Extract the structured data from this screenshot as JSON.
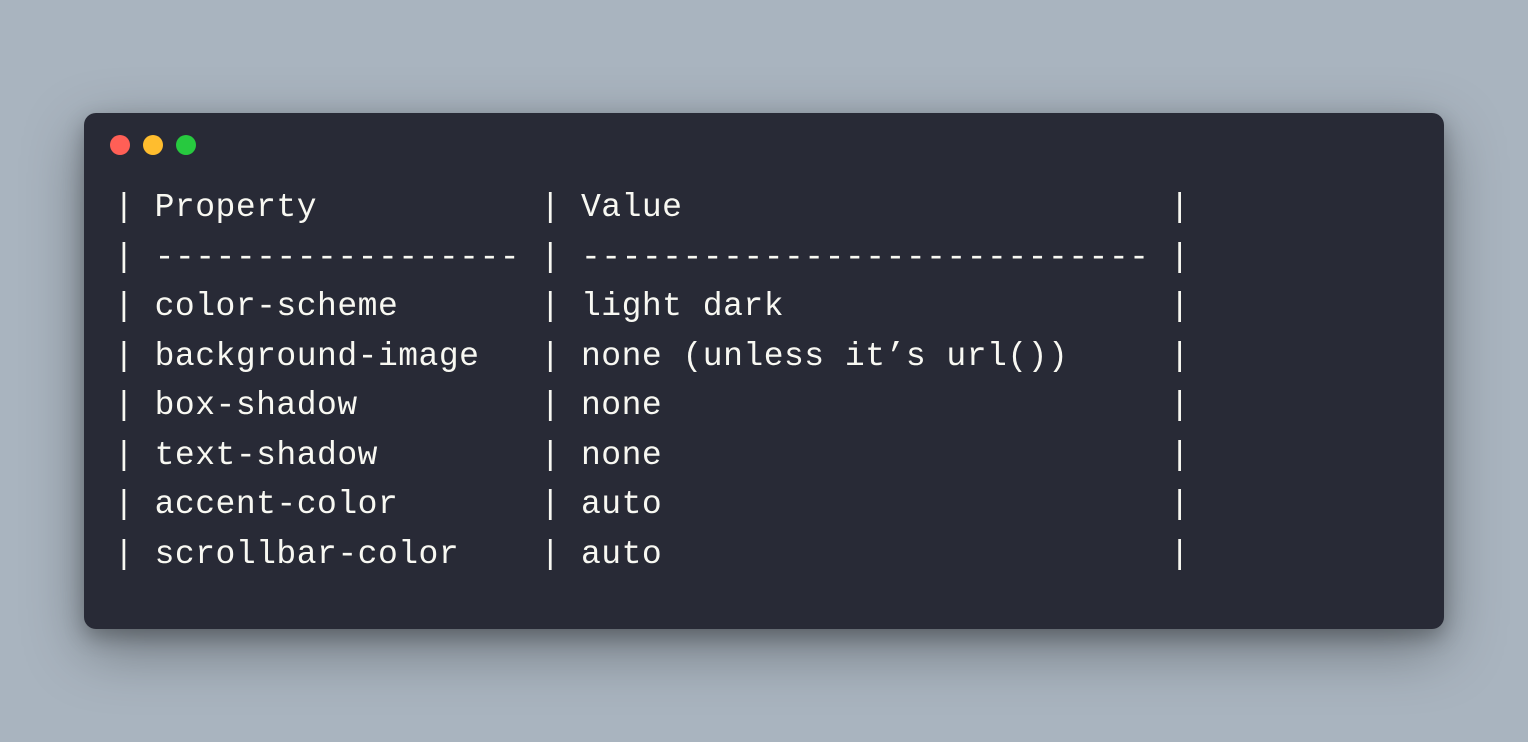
{
  "colors": {
    "page_bg": "#a9b4bf",
    "window_bg": "#282a36",
    "text": "#f8f8f2",
    "dot_close": "#ff5f56",
    "dot_min": "#ffbd2e",
    "dot_max": "#27c93f"
  },
  "table": {
    "header": {
      "property": "Property",
      "value": "Value"
    },
    "rows": [
      {
        "property": "color-scheme",
        "value": "light dark"
      },
      {
        "property": "background-image",
        "value": "none (unless it’s url())"
      },
      {
        "property": "box-shadow",
        "value": "none"
      },
      {
        "property": "text-shadow",
        "value": "none"
      },
      {
        "property": "accent-color",
        "value": "auto"
      },
      {
        "property": "scrollbar-color",
        "value": "auto"
      }
    ],
    "col_widths": {
      "property": 18,
      "value": 28
    }
  }
}
